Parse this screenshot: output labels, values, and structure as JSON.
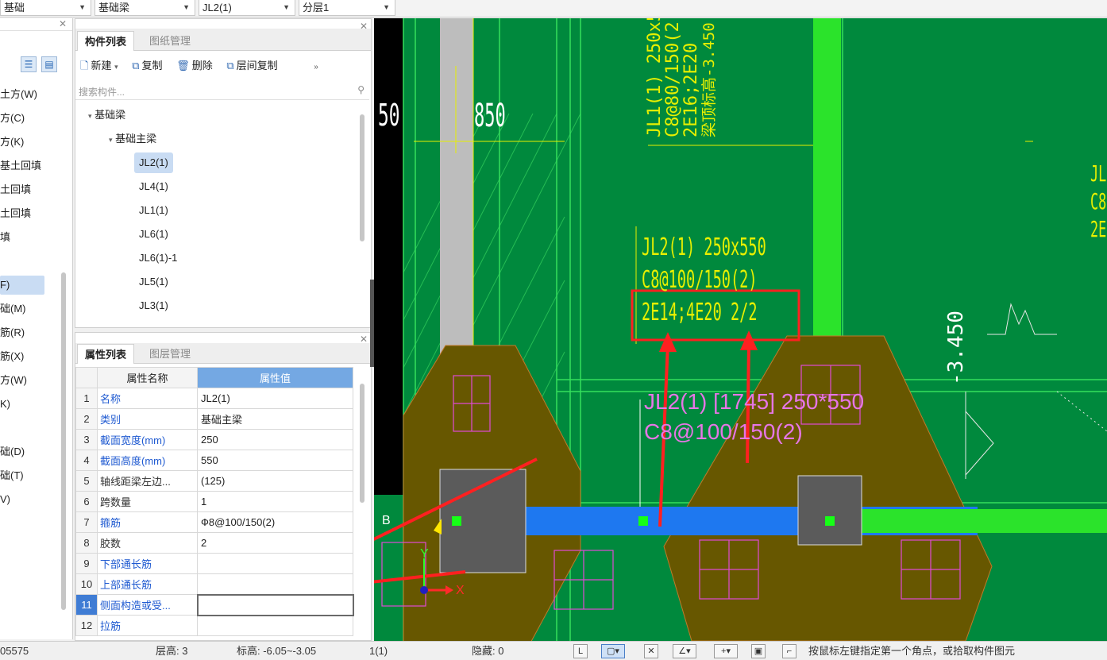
{
  "top_combos": [
    {
      "value": "基础"
    },
    {
      "value": "基础梁"
    },
    {
      "value": "JL2(1)"
    },
    {
      "value": "分层1"
    }
  ],
  "left_nav": {
    "items": [
      "土方(W)",
      "方(C)",
      "方(K)",
      "基土回填",
      "土回填",
      "土回填",
      "填",
      "F)",
      "础(M)",
      "筋(R)",
      "筋(X)",
      "方(W)",
      "K)",
      "础(D)",
      "础(T)",
      "V)"
    ]
  },
  "component_panel": {
    "tabs": [
      "构件列表",
      "图纸管理"
    ],
    "toolbar": {
      "new": "新建",
      "copy": "复制",
      "delete": "删除",
      "floor_copy": "层间复制"
    },
    "search_placeholder": "搜索构件...",
    "tree": {
      "root": "基础梁",
      "group": "基础主梁",
      "items": [
        "JL2(1)",
        "JL4(1)",
        "JL1(1)",
        "JL6(1)",
        "JL6(1)-1",
        "JL5(1)",
        "JL3(1)"
      ]
    }
  },
  "property_panel": {
    "tabs": [
      "属性列表",
      "图层管理"
    ],
    "headers": {
      "name": "属性名称",
      "value": "属性值"
    },
    "rows": [
      {
        "no": "1",
        "name": "名称",
        "value": "JL2(1)"
      },
      {
        "no": "2",
        "name": "类别",
        "value": "基础主梁"
      },
      {
        "no": "3",
        "name": "截面宽度(mm)",
        "value": "250"
      },
      {
        "no": "4",
        "name": "截面高度(mm)",
        "value": "550"
      },
      {
        "no": "5",
        "name": "轴线距梁左边...",
        "value": "(125)"
      },
      {
        "no": "6",
        "name": "跨数量",
        "value": "1"
      },
      {
        "no": "7",
        "name": "箍筋",
        "value": "Ф8@100/150(2)"
      },
      {
        "no": "8",
        "name": "胶数",
        "value": "2"
      },
      {
        "no": "9",
        "name": "下部通长筋",
        "value": ""
      },
      {
        "no": "10",
        "name": "上部通长筋",
        "value": ""
      },
      {
        "no": "11",
        "name": "侧面构造或受...",
        "value": ""
      },
      {
        "no": "12",
        "name": "拉筋",
        "value": ""
      }
    ]
  },
  "canvas": {
    "dim_850": "850",
    "dim_left": "50",
    "beam_label_top": [
      "JL1(1) 250x5",
      "C8@80/150(2",
      "2E16;2E20",
      "梁顶标高-3.450"
    ],
    "beam_label_main": [
      "JL2(1) 250x550",
      "C8@100/150(2)",
      "2E14;4E20 2/2"
    ],
    "beam_label_right": [
      "JL",
      "C8",
      "2E"
    ],
    "elevation": "-3.450",
    "beam_tag_line1": "JL2(1) [1745] 250*550",
    "beam_tag_line2": "C8@100/150(2)",
    "axis_x": "X",
    "axis_y": "Y",
    "grid_b": "B",
    "colors": {
      "bg": "#00893d",
      "beam_blue": "#1e78f0",
      "footing": "#675700",
      "text_yellow": "#e8f000",
      "text_magenta": "#e676e6",
      "arrow_red": "#ff2020"
    }
  },
  "status": {
    "coord": "05575",
    "floor_label": "层高: 3",
    "elev_label": "标高: -6.05~-3.05",
    "count": "1(1)",
    "hidden_label": "隐藏: 0",
    "hint": "按鼠标左键指定第一个角点，或拾取构件图元"
  }
}
